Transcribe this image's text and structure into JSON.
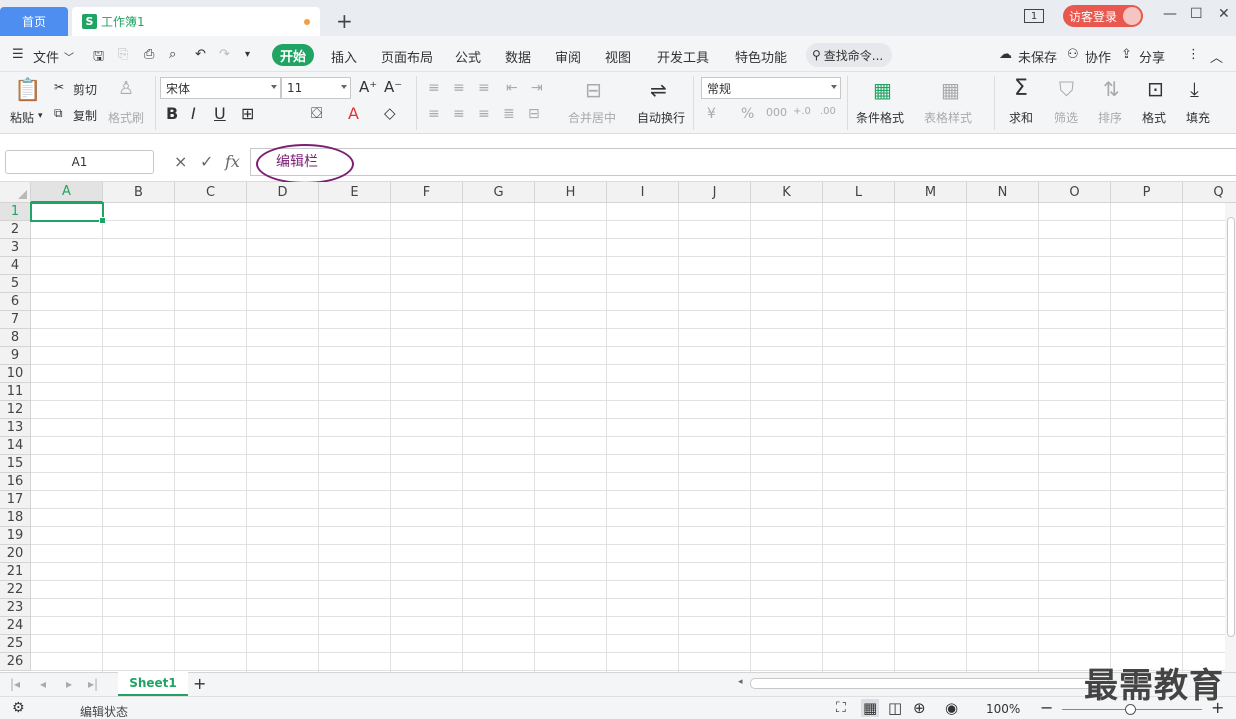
{
  "titlebar": {
    "home_tab": "首页",
    "doc_icon": "S",
    "doc_tab": "工作簿1",
    "new_tab": "+",
    "window_badge": "1",
    "login": "访客登录"
  },
  "menu": {
    "file": "文件",
    "start": "开始",
    "items": [
      "插入",
      "页面布局",
      "公式",
      "数据",
      "审阅",
      "视图",
      "开发工具",
      "特色功能"
    ],
    "search": "查找命令...",
    "unsaved": "未保存",
    "collab": "协作",
    "share": "分享"
  },
  "ribbon": {
    "paste": "粘贴",
    "cut": "剪切",
    "copy": "复制",
    "format_painter": "格式刷",
    "font_name": "宋体",
    "font_size": "11",
    "merge_center": "合并居中",
    "wrap_text": "自动换行",
    "number_format": "常规",
    "cond_format": "条件格式",
    "table_style": "表格样式",
    "sum": "求和",
    "filter": "筛选",
    "sort": "排序",
    "format": "格式",
    "fill": "填充"
  },
  "formula_bar": {
    "name_box": "A1",
    "cancel": "×",
    "confirm": "✓",
    "fx": "fx",
    "annotation": "编辑栏"
  },
  "grid": {
    "columns": [
      "A",
      "B",
      "C",
      "D",
      "E",
      "F",
      "G",
      "H",
      "I",
      "J",
      "K",
      "L",
      "M",
      "N",
      "O",
      "P",
      "Q"
    ],
    "rows": [
      "1",
      "2",
      "3",
      "4",
      "5",
      "6",
      "7",
      "8",
      "9",
      "10",
      "11",
      "12",
      "13",
      "14",
      "15",
      "16",
      "17",
      "18",
      "19",
      "20",
      "21",
      "22",
      "23",
      "24",
      "25",
      "26"
    ],
    "active_cell": "A1"
  },
  "sheets": {
    "tabs": [
      "Sheet1"
    ],
    "add": "+"
  },
  "status": {
    "mode": "编辑状态",
    "zoom": "100%",
    "zoom_value": 100
  },
  "watermark": "最需教育"
}
